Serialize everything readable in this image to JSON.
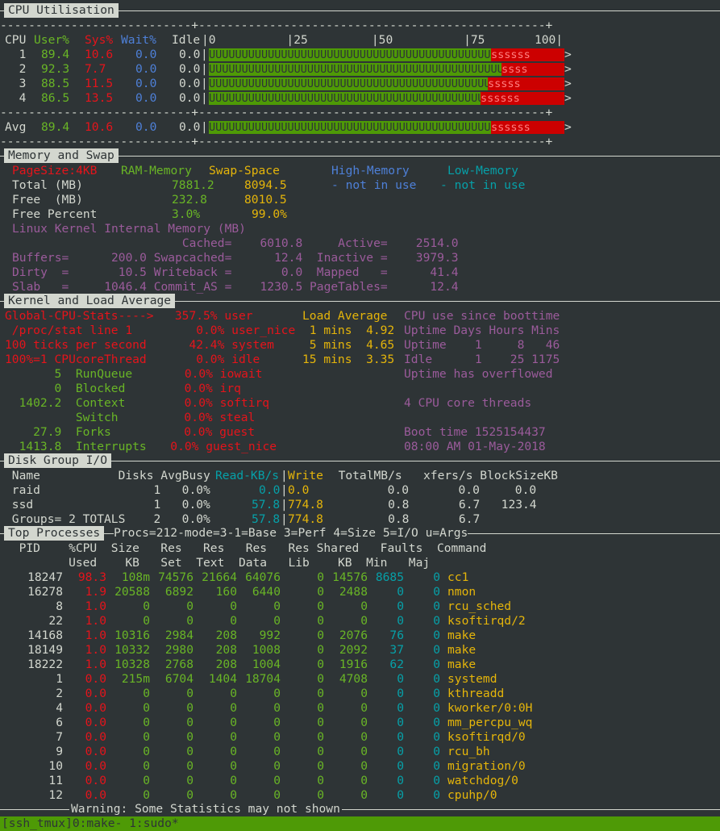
{
  "top_fragment": "",
  "cpu": {
    "section_title": "CPU Utilisation",
    "dash_line": "---------------------------+-------------------------------------------------+",
    "header": {
      "cpu": "CPU",
      "user": "User%",
      "sys": "Sys%",
      "wait": "Wait%",
      "idle": "Idle",
      "scale": "|0          |25         |50          |75       100|"
    },
    "rows": [
      {
        "cpu": "  1",
        "user": "89.4",
        "sys": "10.6",
        "wait": "0.0",
        "idle": "0.0",
        "user_pct": 89.4,
        "sys_pct": 10.6,
        "ubar": "UUUUUUUUUUUUUUUUUUUUUUUUUUUUUUUUUUUUUUUUUUUUUUUUUU",
        "sbar": "ssssss",
        "end": ">"
      },
      {
        "cpu": "  2",
        "user": "92.3",
        "sys": "7.7",
        "wait": "0.0",
        "idle": "0.0",
        "user_pct": 92.3,
        "sys_pct": 7.7,
        "ubar": "UUUUUUUUUUUUUUUUUUUUUUUUUUUUUUUUUUUUUUUUUUUUUUUUUUU",
        "sbar": "ssss",
        "end": ">"
      },
      {
        "cpu": "  3",
        "user": "88.5",
        "sys": "11.5",
        "wait": "0.0",
        "idle": "0.0",
        "user_pct": 88.5,
        "sys_pct": 11.5,
        "ubar": "UUUUUUUUUUUUUUUUUUUUUUUUUUUUUUUUUUUUUUUUUUUUUUUUUUU",
        "sbar": "sssss",
        "end": ">"
      },
      {
        "cpu": "  4",
        "user": "86.5",
        "sys": "13.5",
        "wait": "0.0",
        "idle": "0.0",
        "user_pct": 86.5,
        "sys_pct": 13.5,
        "ubar": "UUUUUUUUUUUUUUUUUUUUUUUUUUUUUUUUUUUUUUUUUUUUUUUUUU",
        "sbar": "ssssss",
        "end": ">"
      }
    ],
    "avg": {
      "cpu": "Avg",
      "user": "89.4",
      "sys": "10.6",
      "wait": "0.0",
      "idle": "0.0",
      "user_pct": 89.4,
      "sys_pct": 10.6,
      "ubar": "UUUUUUUUUUUUUUUUUUUUUUUUUUUUUUUUUUUUUUUUUUUUUUUUUU",
      "sbar": "ssssss",
      "end": ">"
    }
  },
  "memory": {
    "section_title": "Memory and Swap",
    "pagesize": "PageSize:4KB",
    "ram": "RAM-Memory",
    "swap": "Swap-Space",
    "high": "High-Memory",
    "low": "Low-Memory",
    "total_label": "Total (MB)",
    "total_ram": "7881.2",
    "total_swap": "8094.5",
    "high_status": "- not in use",
    "low_status": "- not in use",
    "free_label": "Free  (MB)",
    "free_ram": "232.8",
    "free_swap": "8010.5",
    "freepct_label": "Free Percent",
    "freepct_ram": "3.0%",
    "freepct_swap": "99.0%",
    "kernel_line": "Linux Kernel Internal Memory (MB)",
    "k1": "                        Cached=    6010.8     Active=    2514.0",
    "k2": "Buffers=      200.0 Swapcached=      12.4  Inactive =    3979.3",
    "k3": "Dirty  =       10.5 Writeback =       0.0  Mapped   =      41.4",
    "k4": "Slab   =     1046.4 Commit_AS =    1230.5 PageTables=      12.4"
  },
  "kernel": {
    "section_title": "Kernel and Load Average",
    "r1": {
      "a": "Global-CPU-Stats---->   357.5% user",
      "b": "Load Average",
      "c": "CPU use since boottime"
    },
    "r2": {
      "a": " /proc/stat line 1         0.0% user_nice",
      "b": " 1 mins  4.92",
      "c": "Uptime Days Hours Mins"
    },
    "r3": {
      "a": "100 ticks per second      42.4% system",
      "b": " 5 mins  4.65",
      "c": "Uptime    1     8   46"
    },
    "r4": {
      "a": "100%=1 CPUcoreThread       0.0% idle",
      "b": "15 mins  3.35",
      "c": "Idle      1    25 1175"
    },
    "r5": {
      "g": "       5  RunQueue",
      "p": "          0.0% iowait",
      "c": "Uptime has overflowed"
    },
    "r6": {
      "g": "       0  Blocked",
      "p": "           0.0% irq"
    },
    "r7": {
      "g": "  1402.2  Context",
      "p": "           0.0% softirq",
      "c": "4 CPU core threads"
    },
    "r8": {
      "g": "          Switch",
      "p": "            0.0% steal"
    },
    "r9": {
      "g": "    27.9  Forks",
      "p": "             0.0% guest",
      "c": "Boot time 1525154437"
    },
    "r10": {
      "g": "  1413.8  Interrupts",
      "p": "        0.0% guest_nice",
      "c": "08:00 AM 01-May-2018"
    }
  },
  "disk": {
    "section_title": "Disk Group I/O",
    "header": {
      "a": " Name           Disks AvgBusy ",
      "read": "Read-KB/s",
      "sep": "|",
      "write": "Write",
      "b": "  TotalMB/s   xfers/s BlockSizeKB"
    },
    "rows": [
      {
        "name": " raid                1   0.0%      ",
        "read": "0.0",
        "sep": "|",
        "write": "0.0",
        "rest": "           0.0       0.0     0.0"
      },
      {
        "name": " ssd                 1   0.0%     ",
        "read": "57.8",
        "sep": "|",
        "write": "774.8",
        "rest": "         0.8       6.7   123.4"
      },
      {
        "name": " Groups= 2 TOTALS    2   0.0%     ",
        "read": "57.8",
        "sep": "|",
        "write": "774.8",
        "rest": "         0.8       6.7"
      }
    ]
  },
  "processes": {
    "section_title": "Top Processes",
    "mode_text": "Procs=212-mode=3-1=Base 3=Perf 4=Size 5=I/O u=Args",
    "h1": "  PID    %CPU  Size   Res   Res   Res   Res Shared   Faults  Command",
    "h2": "         Used    KB   Set  Text  Data   Lib    KB  Min   Maj",
    "rows": [
      {
        "pid": "18247",
        "cpu": "98.3",
        "size": "108m",
        "res": "74576",
        "text": "21664",
        "data": "64076",
        "lib": "0",
        "shared": "14576",
        "min": "8685",
        "maj": "0",
        "cmd": "cc1"
      },
      {
        "pid": "16278",
        "cpu": "1.9",
        "size": "20588",
        "res": "6892",
        "text": "160",
        "data": "6440",
        "lib": "0",
        "shared": "2488",
        "min": "0",
        "maj": "0",
        "cmd": "nmon"
      },
      {
        "pid": "8",
        "cpu": "1.0",
        "size": "0",
        "res": "0",
        "text": "0",
        "data": "0",
        "lib": "0",
        "shared": "0",
        "min": "0",
        "maj": "0",
        "cmd": "rcu_sched"
      },
      {
        "pid": "22",
        "cpu": "1.0",
        "size": "0",
        "res": "0",
        "text": "0",
        "data": "0",
        "lib": "0",
        "shared": "0",
        "min": "0",
        "maj": "0",
        "cmd": "ksoftirqd/2"
      },
      {
        "pid": "14168",
        "cpu": "1.0",
        "size": "10316",
        "res": "2984",
        "text": "208",
        "data": "992",
        "lib": "0",
        "shared": "2076",
        "min": "76",
        "maj": "0",
        "cmd": "make"
      },
      {
        "pid": "18149",
        "cpu": "1.0",
        "size": "10332",
        "res": "2980",
        "text": "208",
        "data": "1008",
        "lib": "0",
        "shared": "2092",
        "min": "37",
        "maj": "0",
        "cmd": "make"
      },
      {
        "pid": "18222",
        "cpu": "1.0",
        "size": "10328",
        "res": "2768",
        "text": "208",
        "data": "1004",
        "lib": "0",
        "shared": "1916",
        "min": "62",
        "maj": "0",
        "cmd": "make"
      },
      {
        "pid": "1",
        "cpu": "0.0",
        "size": "215m",
        "res": "6704",
        "text": "1404",
        "data": "18704",
        "lib": "0",
        "shared": "4708",
        "min": "0",
        "maj": "0",
        "cmd": "systemd"
      },
      {
        "pid": "2",
        "cpu": "0.0",
        "size": "0",
        "res": "0",
        "text": "0",
        "data": "0",
        "lib": "0",
        "shared": "0",
        "min": "0",
        "maj": "0",
        "cmd": "kthreadd"
      },
      {
        "pid": "4",
        "cpu": "0.0",
        "size": "0",
        "res": "0",
        "text": "0",
        "data": "0",
        "lib": "0",
        "shared": "0",
        "min": "0",
        "maj": "0",
        "cmd": "kworker/0:0H"
      },
      {
        "pid": "6",
        "cpu": "0.0",
        "size": "0",
        "res": "0",
        "text": "0",
        "data": "0",
        "lib": "0",
        "shared": "0",
        "min": "0",
        "maj": "0",
        "cmd": "mm_percpu_wq"
      },
      {
        "pid": "7",
        "cpu": "0.0",
        "size": "0",
        "res": "0",
        "text": "0",
        "data": "0",
        "lib": "0",
        "shared": "0",
        "min": "0",
        "maj": "0",
        "cmd": "ksoftirqd/0"
      },
      {
        "pid": "9",
        "cpu": "0.0",
        "size": "0",
        "res": "0",
        "text": "0",
        "data": "0",
        "lib": "0",
        "shared": "0",
        "min": "0",
        "maj": "0",
        "cmd": "rcu_bh"
      },
      {
        "pid": "10",
        "cpu": "0.0",
        "size": "0",
        "res": "0",
        "text": "0",
        "data": "0",
        "lib": "0",
        "shared": "0",
        "min": "0",
        "maj": "0",
        "cmd": "migration/0"
      },
      {
        "pid": "11",
        "cpu": "0.0",
        "size": "0",
        "res": "0",
        "text": "0",
        "data": "0",
        "lib": "0",
        "shared": "0",
        "min": "0",
        "maj": "0",
        "cmd": "watchdog/0"
      },
      {
        "pid": "12",
        "cpu": "0.0",
        "size": "0",
        "res": "0",
        "text": "0",
        "data": "0",
        "lib": "0",
        "shared": "0",
        "min": "0",
        "maj": "0",
        "cmd": "cpuhp/0"
      }
    ],
    "warning": "Warning: Some Statistics may not shown"
  },
  "tmux": {
    "status": "[ssh_tmux]0:make- 1:sudo*"
  },
  "colors": {
    "background": "#2e3436",
    "user_bar": "#4e9a06",
    "sys_bar": "#cc0000",
    "status_bar": "#4e9a06"
  }
}
